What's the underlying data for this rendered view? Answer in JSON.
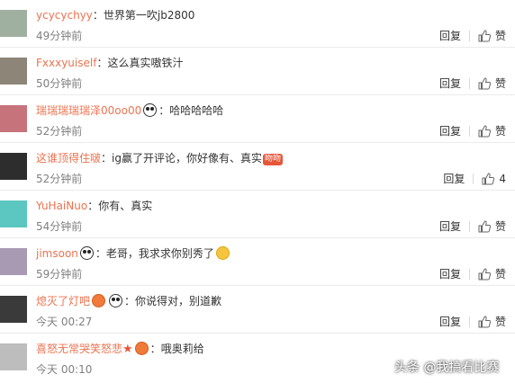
{
  "comments": [
    {
      "user": "ycycychyy",
      "text": "世界第一吹jb2800",
      "time": "49分钟前",
      "likes": "赞",
      "avatar_color": "#9fb0a0"
    },
    {
      "user": "Fxxxyuiself",
      "text": "这么真实嗷铁汁",
      "time": "50分钟前",
      "likes": "赞",
      "avatar_color": "#8c8578"
    },
    {
      "user": "瑞瑞瑞瑞瑞泽00oo00",
      "text": "哈哈哈哈哈",
      "time": "52分钟前",
      "likes": "赞",
      "avatar_color": "#c7737c"
    },
    {
      "user": "这谁顶得住啵",
      "text": "ig赢了开评论，你好像有、真实",
      "time": "52分钟前",
      "likes": "4",
      "avatar_color": "#2d2d2d"
    },
    {
      "user": "YuHaiNuo",
      "text": "你有、真实",
      "time": "54分钟前",
      "likes": "赞",
      "avatar_color": "#5cc6c0"
    },
    {
      "user": "jimsoon",
      "text": "老哥，我求求你别秀了",
      "time": "59分钟前",
      "likes": "赞",
      "avatar_color": "#a99ab3"
    },
    {
      "user": "熄灭了灯吧",
      "text": "你说得对，别道歉",
      "time": "今天 00:27",
      "likes": "赞",
      "avatar_color": "#3a3a3a"
    },
    {
      "user": "喜怒无常哭笑怒悲",
      "text": "哦奥莉给",
      "time": "今天 00:10",
      "likes": "赞",
      "avatar_color": "#bdbdbd"
    }
  ],
  "labels": {
    "reply": "回复",
    "separator": "：",
    "badge": "吻吻"
  },
  "watermark": "头条 @我搞看比赛"
}
